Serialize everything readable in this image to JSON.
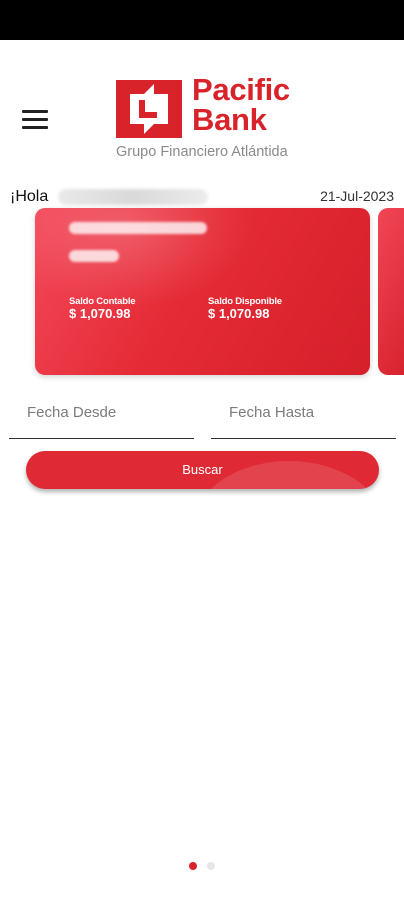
{
  "logo": {
    "line1": "Pacific",
    "line2": "Bank",
    "subtitle": "Grupo Financiero Atlántida",
    "brand_color": "#d8232a"
  },
  "header": {
    "menu_icon": "hamburger-menu-icon"
  },
  "greeting": {
    "prefix": "¡Hola",
    "date": "21-Jul-2023"
  },
  "account_card": {
    "saldo_contable_label": "Saldo Contable",
    "saldo_contable_value": "$ 1,070.98",
    "saldo_disponible_label": "Saldo Disponible",
    "saldo_disponible_value": "$ 1,070.98",
    "card_color": "#e52b36"
  },
  "filters": {
    "fecha_desde_placeholder": "Fecha Desde",
    "fecha_hasta_placeholder": "Fecha Hasta"
  },
  "search_button_label": "Buscar",
  "pagination": {
    "active_color": "#d8232a",
    "inactive_color": "#e6e6e6"
  }
}
